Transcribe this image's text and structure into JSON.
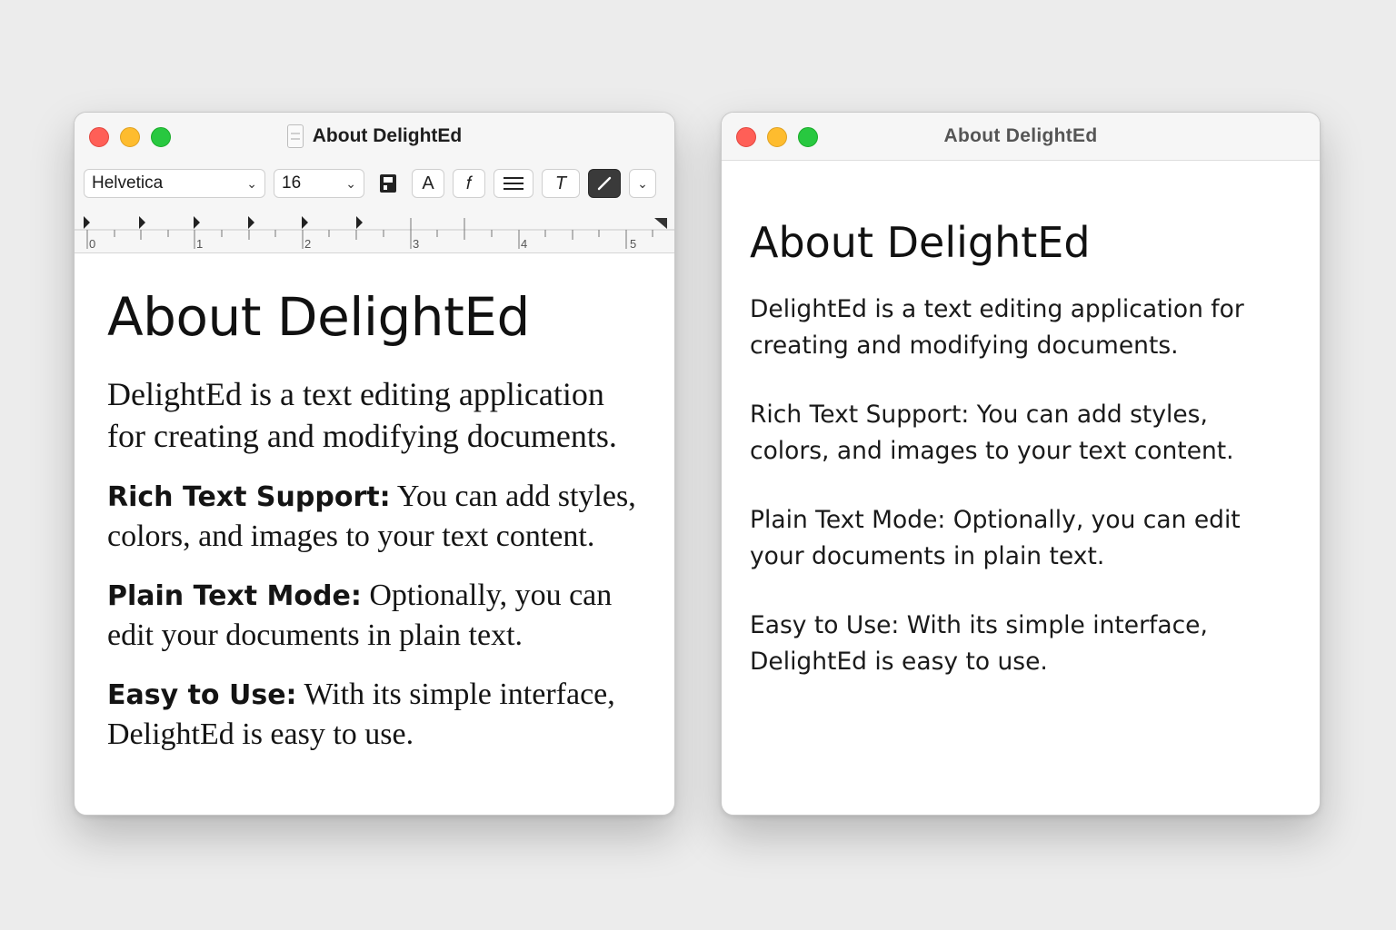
{
  "left_window": {
    "title": "About DelightEd",
    "toolbar": {
      "font_value": "Helvetica",
      "size_value": "16",
      "font_color_button": "A",
      "italic_button": "𝑓",
      "text_style_button": "T"
    },
    "ruler": {
      "labels": [
        "0",
        "1",
        "2",
        "3",
        "4",
        "5"
      ]
    },
    "document": {
      "heading": "About DelightEd",
      "intro": "DelightEd is a text editing application for creating and modifying documents.",
      "features": [
        {
          "label": "Rich Text Support:",
          "text": " You can add styles, colors, and images to your text content."
        },
        {
          "label": "Plain Text Mode:",
          "text": " Optionally, you can edit your documents in plain text."
        },
        {
          "label": "Easy to Use:",
          "text": " With its simple interface, DelightEd is easy to use."
        }
      ]
    }
  },
  "right_window": {
    "title": "About DelightEd",
    "document": {
      "heading": "About DelightEd",
      "paragraphs": [
        "DelightEd is a text editing application for creating and modifying documents.",
        "Rich Text Support: You can add styles, colors, and images to your text content.",
        "Plain Text Mode: Optionally, you can edit your documents in plain text.",
        "Easy to Use: With its simple interface, DelightEd is easy to use."
      ]
    }
  },
  "colors": {
    "close": "#ff5f57",
    "minimize": "#febc2e",
    "zoom": "#28c840",
    "background": "#ececec"
  }
}
